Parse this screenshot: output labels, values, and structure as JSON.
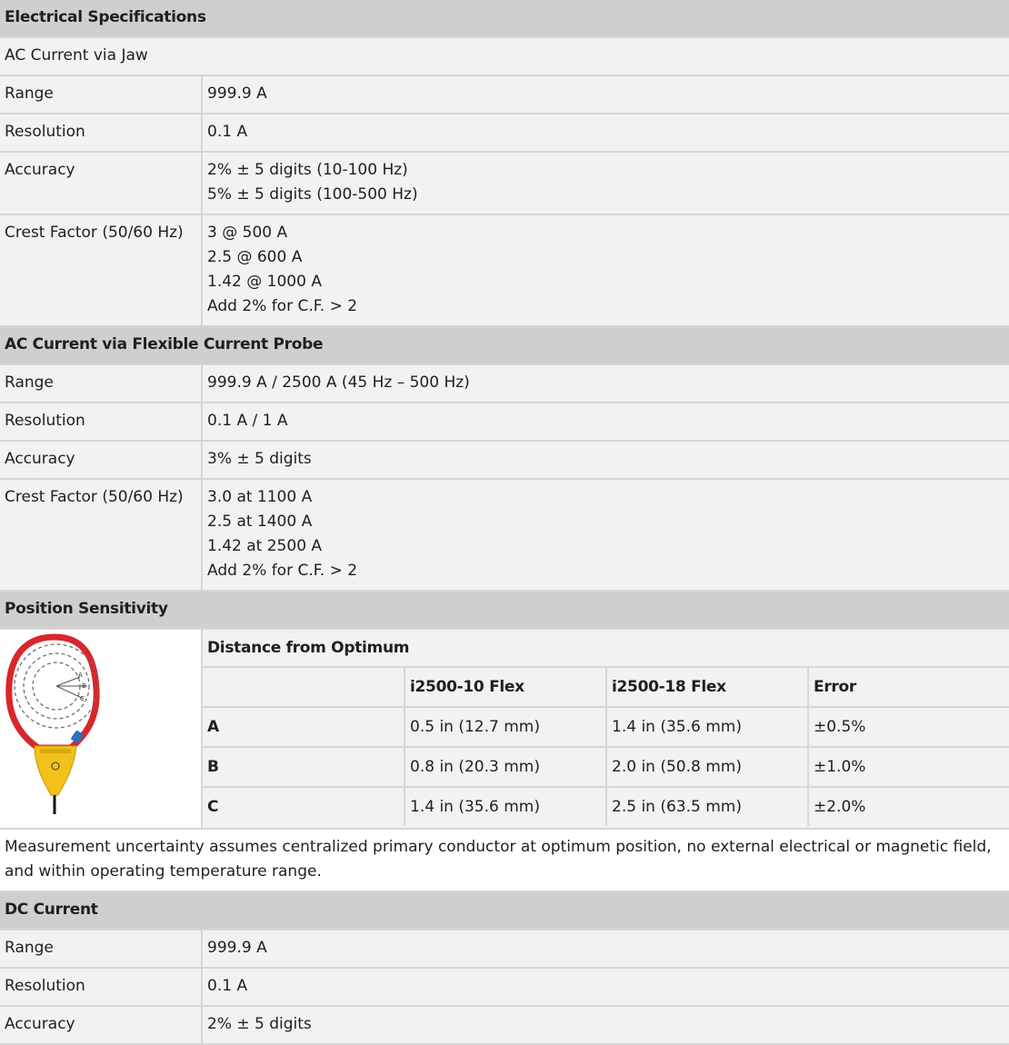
{
  "title": "Electrical Specifications",
  "ac_jaw": {
    "heading": "AC Current via Jaw",
    "range_label": "Range",
    "range_value": "999.9 A",
    "resolution_label": "Resolution",
    "resolution_value": "0.1 A",
    "accuracy_label": "Accuracy",
    "accuracy_lines": [
      "2% ± 5 digits (10-100 Hz)",
      "5% ± 5 digits (100-500 Hz)"
    ],
    "crest_label": "Crest Factor (50/60 Hz)",
    "crest_lines": [
      "3 @ 500 A",
      "2.5 @ 600 A",
      "1.42 @ 1000 A",
      "Add 2% for C.F. > 2"
    ]
  },
  "ac_flex": {
    "heading": "AC Current via Flexible Current Probe",
    "range_label": "Range",
    "range_value": "999.9 A / 2500 A (45 Hz – 500 Hz)",
    "resolution_label": "Resolution",
    "resolution_value": "0.1 A / 1 A",
    "accuracy_label": "Accuracy",
    "accuracy_value": "3% ± 5 digits",
    "crest_label": "Crest Factor (50/60 Hz)",
    "crest_lines": [
      "3.0 at 1100 A",
      "2.5 at 1400 A",
      "1.42 at 2500 A",
      "Add 2% for C.F. > 2"
    ]
  },
  "position": {
    "heading": "Position Sensitivity",
    "distance_heading": "Distance from Optimum",
    "columns": [
      "",
      "i2500-10 Flex",
      "i2500-18 Flex",
      "Error"
    ],
    "rows": [
      {
        "label": "A",
        "flex10": "0.5 in (12.7 mm)",
        "flex18": "1.4 in (35.6 mm)",
        "error": "±0.5%"
      },
      {
        "label": "B",
        "flex10": "0.8 in (20.3 mm)",
        "flex18": "2.0 in (50.8 mm)",
        "error": "±1.0%"
      },
      {
        "label": "C",
        "flex10": "1.4 in (35.6 mm)",
        "flex18": "2.5 in (63.5 mm)",
        "error": "±2.0%"
      }
    ],
    "diagram_letters": [
      "A",
      "B",
      "C"
    ],
    "note": "Measurement uncertainty assumes centralized primary conductor at optimum position, no external electrical or magnetic field, and within operating temperature range."
  },
  "dc": {
    "heading": "DC Current",
    "range_label": "Range",
    "range_value": "999.9 A",
    "resolution_label": "Resolution",
    "resolution_value": "0.1 A",
    "accuracy_label": "Accuracy",
    "accuracy_value": "2% ± 5 digits"
  },
  "colors": {
    "header_bg": "#cfcfcf",
    "row_bg": "#f2f2f2",
    "probe_red": "#d9262b",
    "probe_yellow": "#f2c21b"
  }
}
